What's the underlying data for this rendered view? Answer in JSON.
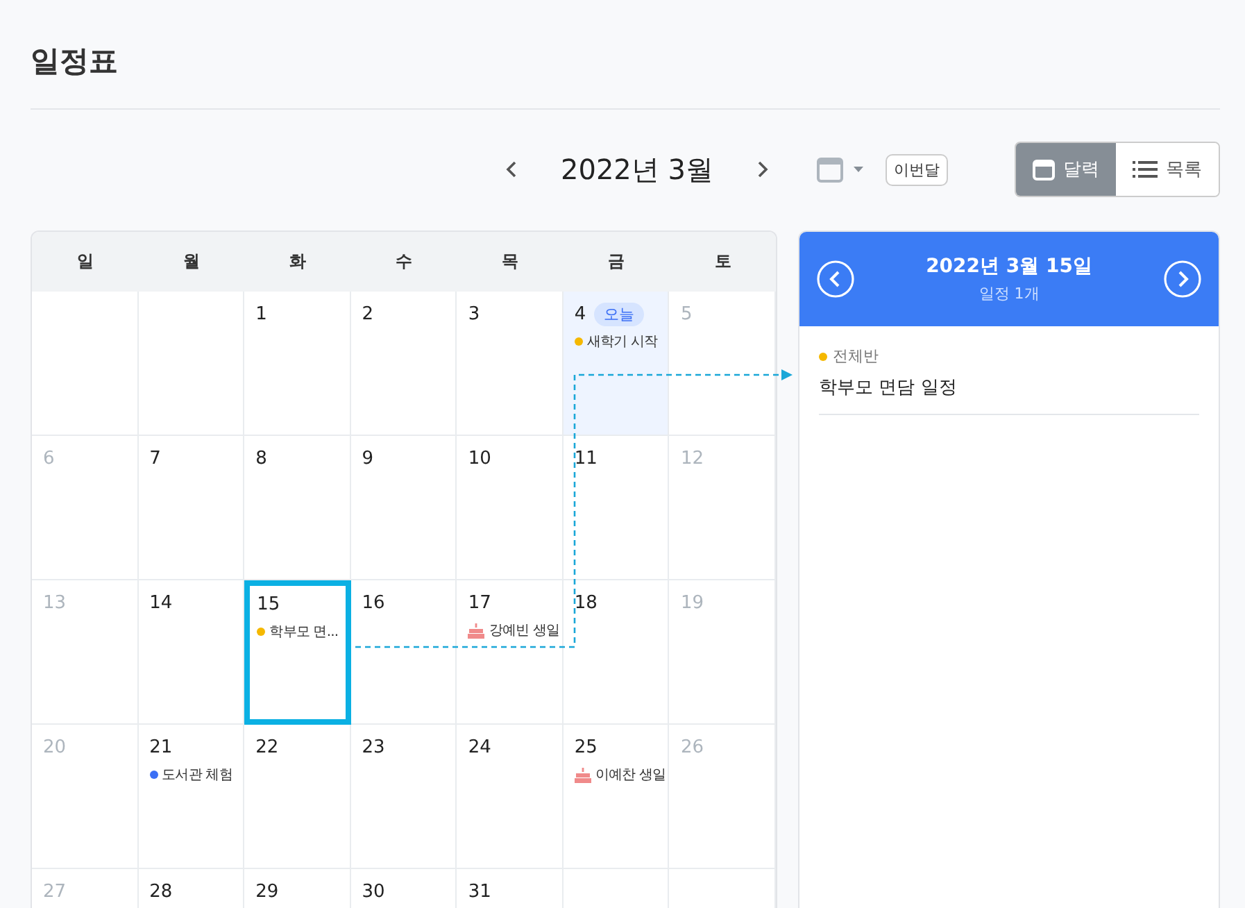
{
  "page": {
    "title": "일정표"
  },
  "toolbar": {
    "month_title": "2022년 3월",
    "this_month_button": "이번달",
    "views": [
      {
        "kind": "calendar",
        "label": "달력",
        "selected": true
      },
      {
        "kind": "list",
        "label": "목록",
        "selected": false
      }
    ]
  },
  "calendar": {
    "weekdays": [
      "일",
      "월",
      "화",
      "수",
      "목",
      "금",
      "토"
    ],
    "weeks": [
      [
        {
          "blank": true
        },
        {
          "blank": true
        },
        {
          "day": "1",
          "weekend": false,
          "today": false,
          "selected": false
        },
        {
          "day": "2",
          "weekend": false,
          "today": false,
          "selected": false
        },
        {
          "day": "3",
          "weekend": false,
          "today": false,
          "selected": false
        },
        {
          "day": "4",
          "weekend": false,
          "today": true,
          "today_badge": "오늘",
          "selected": false,
          "events": [
            {
              "kind": "dot",
              "color": "#f5b800",
              "title": "새학기 시작"
            }
          ]
        },
        {
          "day": "5",
          "weekend": true,
          "today": false,
          "selected": false
        }
      ],
      [
        {
          "day": "6",
          "weekend": true,
          "today": false,
          "selected": false
        },
        {
          "day": "7",
          "weekend": false,
          "today": false,
          "selected": false
        },
        {
          "day": "8",
          "weekend": false,
          "today": false,
          "selected": false
        },
        {
          "day": "9",
          "weekend": false,
          "today": false,
          "selected": false
        },
        {
          "day": "10",
          "weekend": false,
          "today": false,
          "selected": false
        },
        {
          "day": "11",
          "weekend": false,
          "today": false,
          "selected": false
        },
        {
          "day": "12",
          "weekend": true,
          "today": false,
          "selected": false
        }
      ],
      [
        {
          "day": "13",
          "weekend": true,
          "today": false,
          "selected": false
        },
        {
          "day": "14",
          "weekend": false,
          "today": false,
          "selected": false
        },
        {
          "day": "15",
          "weekend": false,
          "today": false,
          "selected": true,
          "events": [
            {
              "kind": "dot",
              "color": "#f5b800",
              "title": "학부모 면..."
            }
          ]
        },
        {
          "day": "16",
          "weekend": false,
          "today": false,
          "selected": false
        },
        {
          "day": "17",
          "weekend": false,
          "today": false,
          "selected": false,
          "events": [
            {
              "kind": "birthday",
              "title": "강예빈 생일"
            }
          ]
        },
        {
          "day": "18",
          "weekend": false,
          "today": false,
          "selected": false
        },
        {
          "day": "19",
          "weekend": true,
          "today": false,
          "selected": false
        }
      ],
      [
        {
          "day": "20",
          "weekend": true,
          "today": false,
          "selected": false
        },
        {
          "day": "21",
          "weekend": false,
          "today": false,
          "selected": false,
          "events": [
            {
              "kind": "dot",
              "color": "#3b6ff5",
              "title": "도서관 체험"
            }
          ]
        },
        {
          "day": "22",
          "weekend": false,
          "today": false,
          "selected": false
        },
        {
          "day": "23",
          "weekend": false,
          "today": false,
          "selected": false
        },
        {
          "day": "24",
          "weekend": false,
          "today": false,
          "selected": false
        },
        {
          "day": "25",
          "weekend": false,
          "today": false,
          "selected": false,
          "events": [
            {
              "kind": "birthday",
              "title": "이예찬 생일"
            }
          ]
        },
        {
          "day": "26",
          "weekend": true,
          "today": false,
          "selected": false
        }
      ],
      [
        {
          "day": "27",
          "weekend": true,
          "today": false,
          "selected": false
        },
        {
          "day": "28",
          "weekend": false,
          "today": false,
          "selected": false
        },
        {
          "day": "29",
          "weekend": false,
          "today": false,
          "selected": false
        },
        {
          "day": "30",
          "weekend": false,
          "today": false,
          "selected": false
        },
        {
          "day": "31",
          "weekend": false,
          "today": false,
          "selected": false
        },
        {
          "blank": true
        },
        {
          "blank": true
        }
      ]
    ]
  },
  "detail_panel": {
    "date": "2022년 3월 15일",
    "count": "일정 1개",
    "events": [
      {
        "group": "전체반",
        "color": "#f5b800",
        "title": "학부모 면담 일정"
      }
    ]
  }
}
